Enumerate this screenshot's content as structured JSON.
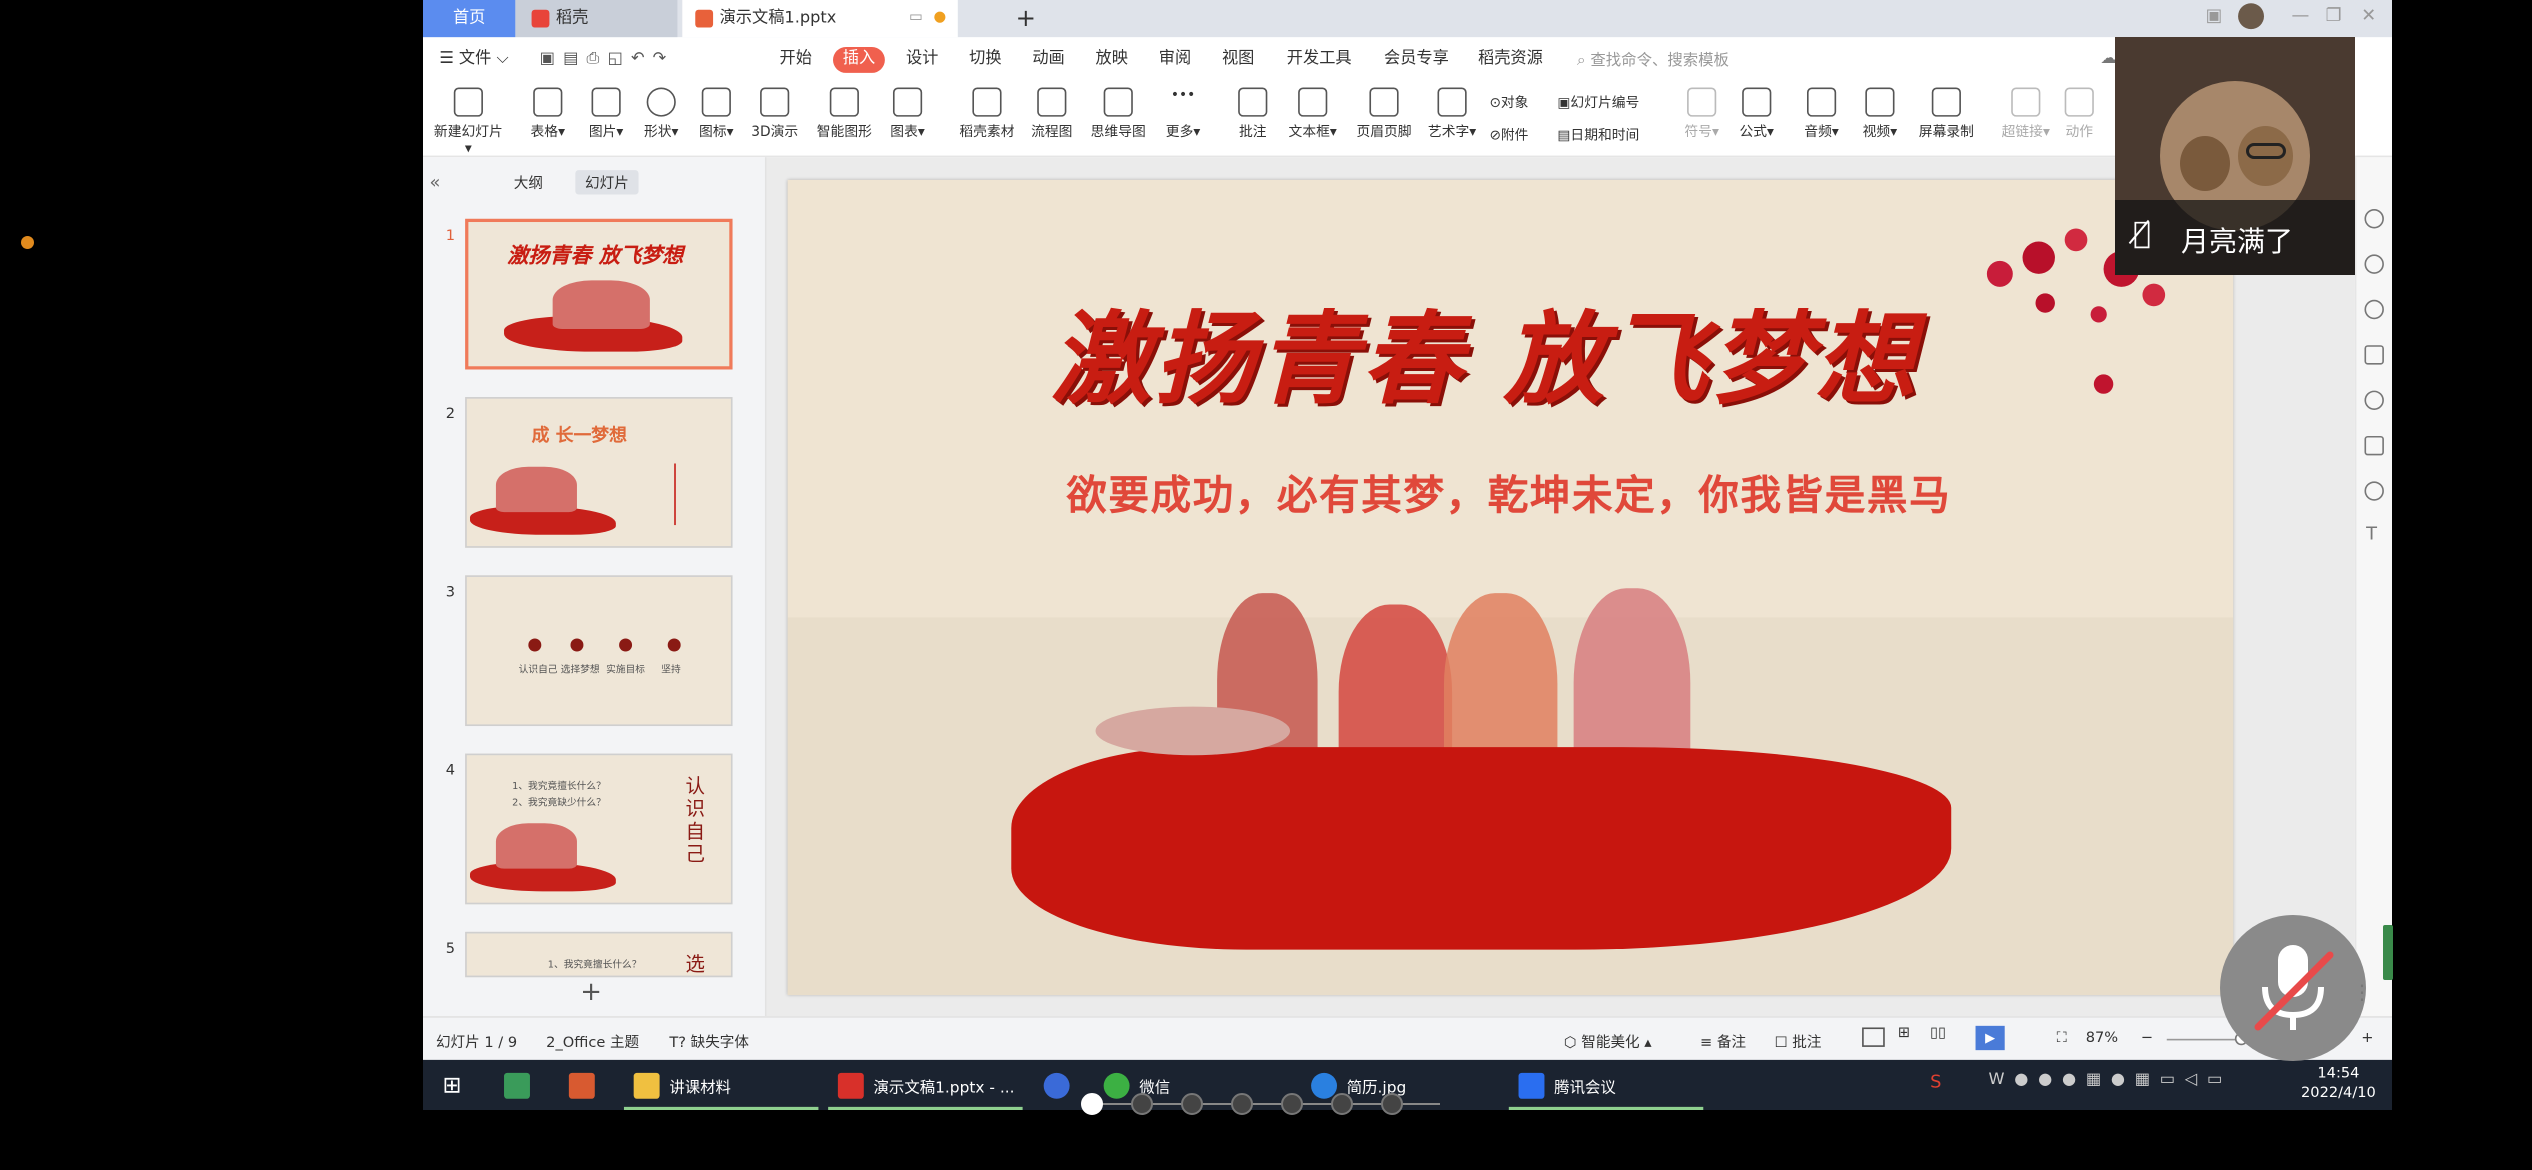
{
  "tabs": {
    "home": "首页",
    "daoke": "稻壳",
    "doc": "演示文稿1.pptx",
    "new_tab": "+"
  },
  "menu": {
    "file": "文件",
    "items": [
      "开始",
      "插入",
      "设计",
      "切换",
      "动画",
      "放映",
      "审阅",
      "视图",
      "开发工具",
      "会员专享",
      "稻壳资源"
    ],
    "active": "插入",
    "search_placeholder": "查找命令、搜索模板"
  },
  "ribbon": {
    "items": [
      "新建幻灯片",
      "表格",
      "图片",
      "形状",
      "图标",
      "3D演示",
      "智能图形",
      "图表",
      "稻壳素材",
      "流程图",
      "思维导图",
      "更多",
      "批注",
      "文本框",
      "页眉页脚",
      "艺术字"
    ],
    "object": "对象",
    "slide_number": "幻灯片编号",
    "attachment": "附件",
    "datetime": "日期和时间",
    "symbol": "符号",
    "formula": "公式",
    "audio": "音频",
    "video": "视频",
    "screen_record": "屏幕录制",
    "hyperlink": "超链接",
    "action": "动作"
  },
  "left_panel": {
    "tab_outline": "大纲",
    "tab_slides": "幻灯片",
    "slide_numbers": [
      "1",
      "2",
      "3",
      "4",
      "5"
    ],
    "thumb2_title": "成 长一梦想",
    "thumb3_labels": [
      "认识自己",
      "选择梦想",
      "实施目标",
      "坚持"
    ],
    "thumb4_lines": [
      "1、我究竟擅长什么？",
      "2、我究竟缺少什么？"
    ],
    "thumb4_side": "认识自己",
    "thumb5_line": "1、我究竟擅长什么？",
    "thumb5_side": "选",
    "add": "+"
  },
  "slide": {
    "title": "激扬青春 放飞梦想",
    "subtitle": "欲要成功，必有其梦，乾坤未定，你我皆是黑马"
  },
  "status": {
    "slide_count": "幻灯片 1 / 9",
    "theme": "2_Office 主题",
    "missing_fonts": "缺失字体",
    "beautify": "智能美化",
    "notes": "备注",
    "comments": "批注",
    "zoom": "87%"
  },
  "taskbar": {
    "items": [
      "讲课材料",
      "演示文稿1.pptx - ...",
      "微信",
      "简历.jpg",
      "腾讯会议"
    ],
    "time": "14:54",
    "date": "2022/4/10"
  },
  "meeting": {
    "participant_name": "月亮满了"
  }
}
